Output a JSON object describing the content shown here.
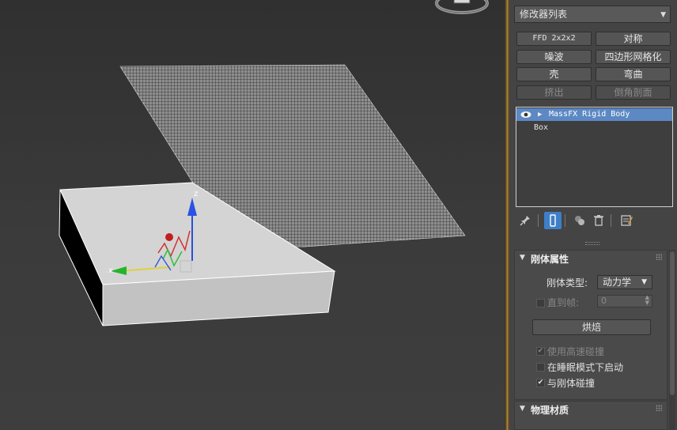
{
  "modifier_list": {
    "label": "修改器列表"
  },
  "modifier_buttons": [
    {
      "label": "FFD 2x2x2",
      "enabled": true
    },
    {
      "label": "对称",
      "enabled": true
    },
    {
      "label": "噪波",
      "enabled": true
    },
    {
      "label": "四边形网格化",
      "enabled": true
    },
    {
      "label": "壳",
      "enabled": true
    },
    {
      "label": "弯曲",
      "enabled": true
    },
    {
      "label": "挤出",
      "enabled": false
    },
    {
      "label": "倒角剖面",
      "enabled": false
    }
  ],
  "modifier_stack": [
    {
      "label": "MassFX Rigid Body",
      "selected": true
    },
    {
      "label": "Box",
      "selected": false
    }
  ],
  "stack_toolbar": [
    "pin-stack-icon",
    "show-end-result-icon",
    "make-unique-icon",
    "remove-modifier-icon",
    "configure-modifier-sets-icon"
  ],
  "rigid_body_rollout": {
    "title": "刚体属性",
    "type_label": "刚体类型:",
    "type_value": "动力学",
    "until_frame_label": "直到帧:",
    "until_frame_value": "0",
    "bake_label": "烘焙",
    "checkboxes": [
      {
        "label": "使用高速碰撞",
        "checked": true,
        "enabled": false
      },
      {
        "label": "在睡眠模式下启动",
        "checked": false,
        "enabled": true
      },
      {
        "label": "与刚体碰撞",
        "checked": true,
        "enabled": true
      }
    ]
  },
  "physical_material_rollout": {
    "title": "物理材质"
  },
  "viewport": {
    "gizmo_z_label": "z",
    "gizmo_x_label": "x"
  },
  "colors": {
    "selection_blue": "#5c88c4",
    "frame_gold": "#b5893a",
    "panel_bg": "#444444"
  }
}
